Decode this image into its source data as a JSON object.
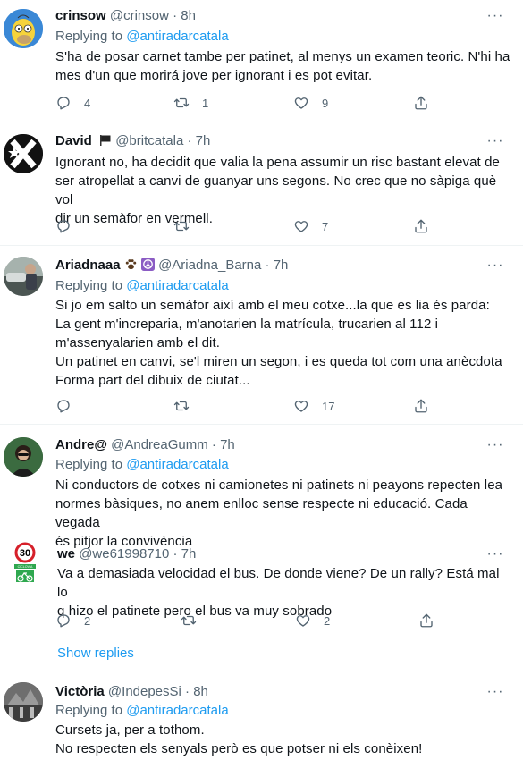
{
  "tweets": [
    {
      "name": "crinsow",
      "handle": "@crinsow",
      "time": "8h",
      "replying_label": "Replying to",
      "replying_to": "@antiradarcatala",
      "text": "S'ha de posar carnet tambe per patinet, al menys un examen teoric. N'hi ha\nmes d'un que morirá jove per ignorant i es pot evitar.",
      "reply_count": "4",
      "retweet_count": "1",
      "like_count": "9"
    },
    {
      "name": "David",
      "handle": "@britcatala",
      "time": "7h",
      "text": "Ignorant no, ha decidit que valia la pena assumir un risc bastant elevat de\nser atropellat a canvi de guanyar uns segons. No crec que no sàpiga què vol\ndir un semàfor en vermell.",
      "reply_count": "",
      "retweet_count": "",
      "like_count": "7"
    },
    {
      "name": "Ariadnaaa",
      "handle": "@Ariadna_Barna",
      "time": "7h",
      "replying_label": "Replying to",
      "replying_to": "@antiradarcatala",
      "text": "Si jo em salto un semàfor així amb el meu cotxe...la que es lia és parda:\nLa gent m'increparia, m'anotarien la matrícula,  trucarien al 112 i\nm'assenyalarien amb el dit.\nUn patinet en canvi, se'l miren un segon, i es queda tot com una anècdota\nForma part del dibuix de ciutat...",
      "reply_count": "",
      "retweet_count": "",
      "like_count": "17"
    },
    {
      "name": "Andre@",
      "handle": "@AndreaGumm",
      "time": "7h",
      "replying_label": "Replying to",
      "replying_to": "@antiradarcatala",
      "text": "Ni conductors de cotxes ni camionetes ni patinets ni peayons repecten lea\nnormes bàsiques, no anem enlloc sense respecte ni educació. Cada vegada\nés pitjor la convivència"
    },
    {
      "name": "we",
      "handle": "@we61998710",
      "time": "7h",
      "text": "Va a demasiada velocidad el bus. De donde viene? De un rally? Está mal lo\nq hizo el patinete pero el bus va muy sobrado",
      "reply_count": "2",
      "retweet_count": "",
      "like_count": "2",
      "avatar_sign_number": "30",
      "avatar_sign_caption": "CICLOVIA"
    },
    {
      "name": "Victòria",
      "handle": "@IndepesSi",
      "time": "8h",
      "replying_label": "Replying to",
      "replying_to": "@antiradarcatala",
      "text": "Cursets ja, per a tothom.\nNo respecten els senyals però es que potser ni els conèixen!"
    }
  ],
  "show_replies": "Show replies",
  "more_glyph": "···",
  "dot": "·",
  "colors": {
    "accent": "#1d9bf0",
    "secondary_text": "#536471",
    "primary_text": "#0f1419",
    "divider": "#eff3f4"
  },
  "icons": [
    "reply-icon",
    "retweet-icon",
    "like-icon",
    "share-icon",
    "more-icon",
    "flag-icon",
    "paw-icon",
    "peace-icon"
  ]
}
